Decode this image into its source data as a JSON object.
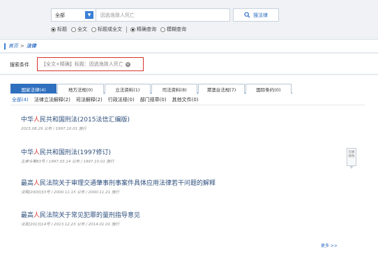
{
  "search": {
    "scope_value": "全部",
    "query_value": "因逃逸致人死亡",
    "button_label": "搜法律"
  },
  "options": {
    "title": "标题",
    "fulltext": "全文",
    "title_or_fulltext": "标题或全文",
    "exact": "精确查询",
    "fuzzy": "模糊查询"
  },
  "breadcrumb": {
    "home": "首页",
    "separator": ">",
    "current": "法律"
  },
  "conditions": {
    "label": "搜索条件",
    "tag_text": "【全文+精确】标题：因逃逸致人死亡"
  },
  "tabs": [
    {
      "label": "国家法律(4)"
    },
    {
      "label": "地方法规(0)"
    },
    {
      "label": "立法资料(1)"
    },
    {
      "label": "司法资料(8)"
    },
    {
      "label": "港澳台法规(7)"
    },
    {
      "label": "国际条约(0)"
    }
  ],
  "subtabs": [
    {
      "label": "全部(4)"
    },
    {
      "label": "法律立法解释(2)"
    },
    {
      "label": "司法解释(2)"
    },
    {
      "label": "行政法规(0)"
    },
    {
      "label": "部门规章(0)"
    },
    {
      "label": "其他文件(0)"
    }
  ],
  "results": [
    {
      "prefix": "中华",
      "highlight": "人",
      "suffix": "民共和国刑法(2015法信汇编版)",
      "meta": "2015.08.29 公布 / 1997.10.01 施行"
    },
    {
      "prefix": "中华",
      "highlight": "人",
      "suffix": "民共和国刑法(1997修订)",
      "meta": "主席令第83号 / 1997.03.14 公布 / 1997.10.01 施行"
    },
    {
      "prefix": "最高",
      "highlight": "人",
      "suffix": "民法院关于审理交通肇事刑事案件具体应用法律若干问题的解释",
      "meta": "法释[2000]33号 / 2000.11.15 公布 / 2000.11.21 施行"
    },
    {
      "prefix": "最高",
      "highlight": "人",
      "suffix": "民法院关于常见犯罪的量刑指导意见",
      "meta": "法发[2013]14号 / 2013.12.23 公布 / 2014.01.01 施行"
    }
  ],
  "side_badge": {
    "line1": "已被",
    "line2": "修改"
  },
  "more_link": "更多 >>"
}
